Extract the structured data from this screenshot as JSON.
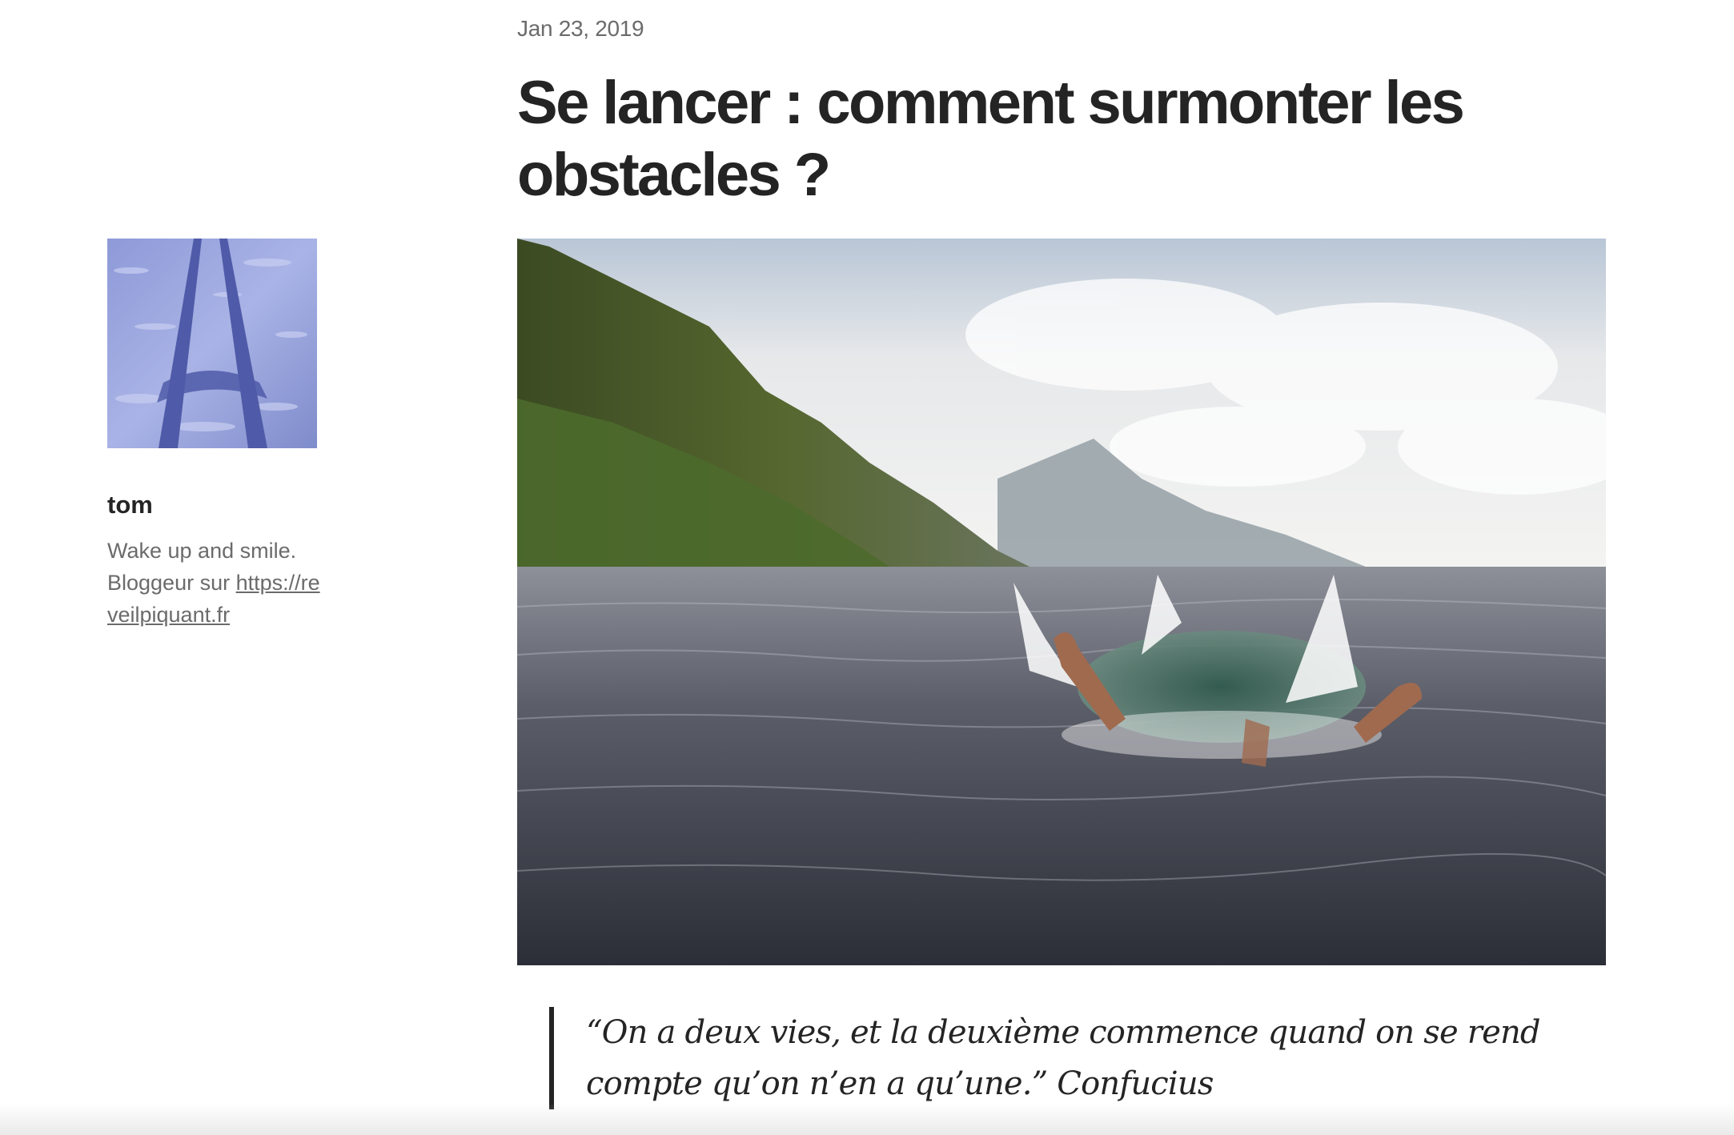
{
  "post": {
    "date": "Jan 23, 2019",
    "title": "Se lancer : comment surmonter les obstacles ?",
    "hero_image_icon": "diver-splash-photo",
    "quote": "“On a deux vies, et la deuxième commence quand on se rend compte qu’on n’en a qu’une.” Confucius"
  },
  "author": {
    "avatar_icon": "shadow-on-snow-photo",
    "name": "tom",
    "bio_line1": "Wake up and smile. Bloggeur sur",
    "link": "https://reveilpiquant.fr"
  },
  "colors": {
    "text": "#242424",
    "muted": "#6b6b6b",
    "background": "#ffffff"
  }
}
